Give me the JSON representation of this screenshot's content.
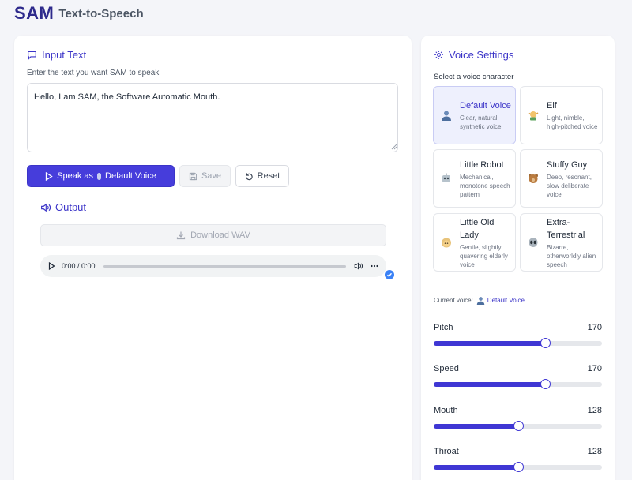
{
  "header": {
    "logo": "SAM",
    "subtitle": "Text-to-Speech"
  },
  "input": {
    "title": "Input Text",
    "hint": "Enter the text you want SAM to speak",
    "value": "Hello, I am SAM, the Software Automatic Mouth."
  },
  "actions": {
    "speak_prefix": "Speak as",
    "speak_voice": "Default Voice",
    "save": "Save",
    "reset": "Reset"
  },
  "output": {
    "title": "Output",
    "download": "Download WAV",
    "player_time": "0:00 / 0:00"
  },
  "settings": {
    "title": "Voice Settings",
    "select_label": "Select a voice character",
    "voices": [
      {
        "name": "Default Voice",
        "desc": "Clear, natural synthetic voice",
        "icon": "person-icon",
        "selected": true
      },
      {
        "name": "Elf",
        "desc": "Light, nimble, high-pitched voice",
        "icon": "elf-icon",
        "selected": false
      },
      {
        "name": "Little Robot",
        "desc": "Mechanical, monotone speech pattern",
        "icon": "robot-icon",
        "selected": false
      },
      {
        "name": "Stuffy Guy",
        "desc": "Deep, resonant, slow deliberate voice",
        "icon": "bear-icon",
        "selected": false
      },
      {
        "name": "Little Old Lady",
        "desc": "Gentle, slightly quavering elderly voice",
        "icon": "old-lady-icon",
        "selected": false
      },
      {
        "name": "Extra-Terrestrial",
        "desc": "Bizarre, otherworldly alien speech",
        "icon": "alien-icon",
        "selected": false
      }
    ],
    "current_voice_label": "Current voice:",
    "current_voice": "Default Voice",
    "sliders": [
      {
        "label": "Pitch",
        "value": "170",
        "fraction": 0.66
      },
      {
        "label": "Speed",
        "value": "170",
        "fraction": 0.66
      },
      {
        "label": "Mouth",
        "value": "128",
        "fraction": 0.5
      },
      {
        "label": "Throat",
        "value": "128",
        "fraction": 0.5
      }
    ]
  },
  "colors": {
    "accent": "#463ddb",
    "brand": "#2e2a8c",
    "selected_bg": "#eef0fd"
  }
}
